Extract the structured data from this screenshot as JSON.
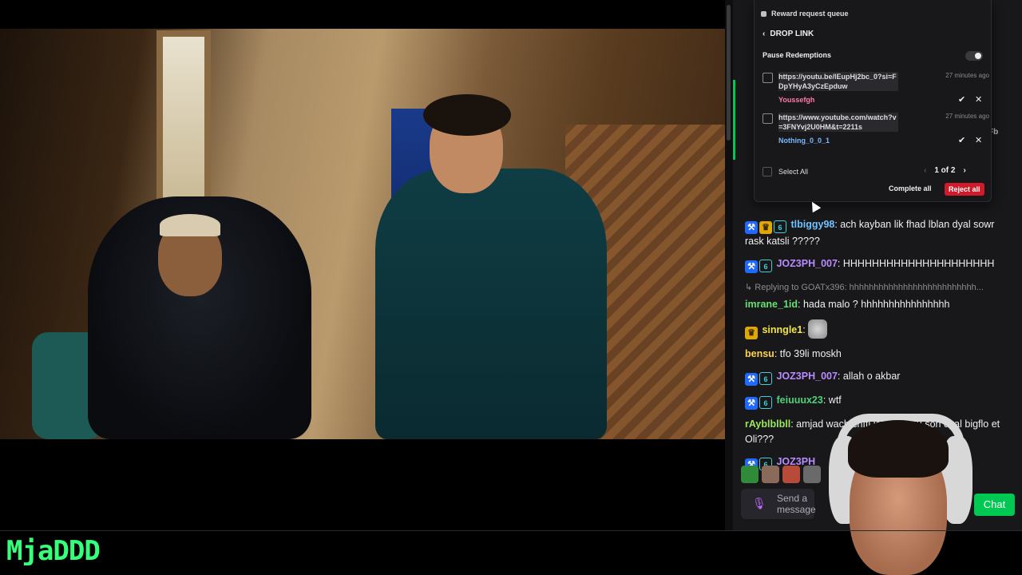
{
  "reward_queue": {
    "header": "Reward request queue",
    "back_label": "DROP LINK",
    "pause_label": "Pause Redemptions",
    "requests": [
      {
        "url": "https://youtu.be/lEupHj2bc_0?si=FDpYHyA3yCzEpduw",
        "time": "27 minutes ago",
        "user": "Youssefgh",
        "user_color": "#ff7aa8"
      },
      {
        "url": "https://www.youtube.com/watch?v=3FNYvj2U0HM&t=2211s",
        "time": "27 minutes ago",
        "user": "Nothing_0_0_1",
        "user_color": "#7ab8ff"
      }
    ],
    "select_all": "Select All",
    "pager": "1 of 2",
    "complete_all": "Complete all",
    "reject_all": "Reject all"
  },
  "chat": {
    "messages": [
      {
        "user": "tlbiggy98",
        "user_color": "#6ec3ff",
        "text": ": ach kayban lik fhad lblan dyal sowr rask katsli ?????",
        "badges": [
          "blue",
          "gold",
          "teal"
        ]
      },
      {
        "user": "JOZ3PH_007",
        "user_color": "#b88cff",
        "text": ": HHHHHHHHHHHHHHHHHHHHH",
        "badges": [
          "blue",
          "teal"
        ]
      },
      {
        "reply": "Replying to GOATx396: hhhhhhhhhhhhhhhhhhhhhhhhhh...",
        "user": "imrane_1id",
        "user_color": "#66e070",
        "text": ": hada malo ? hhhhhhhhhhhhhhhh",
        "badges": []
      },
      {
        "user": "sinngle1",
        "user_color": "#f5e642",
        "text": ":",
        "badges": [
          "gold"
        ],
        "emote": "cat-emote"
      },
      {
        "user": "bensu",
        "user_color": "#ffd24a",
        "text": ": tfo 39li moskh",
        "badges": []
      },
      {
        "user": "JOZ3PH_007",
        "user_color": "#b88cff",
        "text": ": allah o akbar",
        "badges": [
          "blue",
          "teal"
        ]
      },
      {
        "user": "feiuuux23",
        "user_color": "#4fd07a",
        "text": ": wtf",
        "badges": [
          "blue",
          "teal"
        ]
      },
      {
        "user": "rAyblblbll",
        "user_color": "#9ae85c",
        "text": ": amjad wach chfti le nouveau son dyal bigflo et Oli???",
        "badges": []
      },
      {
        "user": "JOZ3PH",
        "user_color": "#b88cff",
        "text": "",
        "badges": [
          "blue",
          "teal"
        ]
      }
    ],
    "input_placeholder": "Send a message",
    "chat_button": "Chat",
    "partial_label": "Fb"
  },
  "channel_logo": "MjaDDD",
  "colors": {
    "accent_green": "#00c853",
    "reject_red": "#d11a2a",
    "logo_green": "#36ff7a"
  }
}
